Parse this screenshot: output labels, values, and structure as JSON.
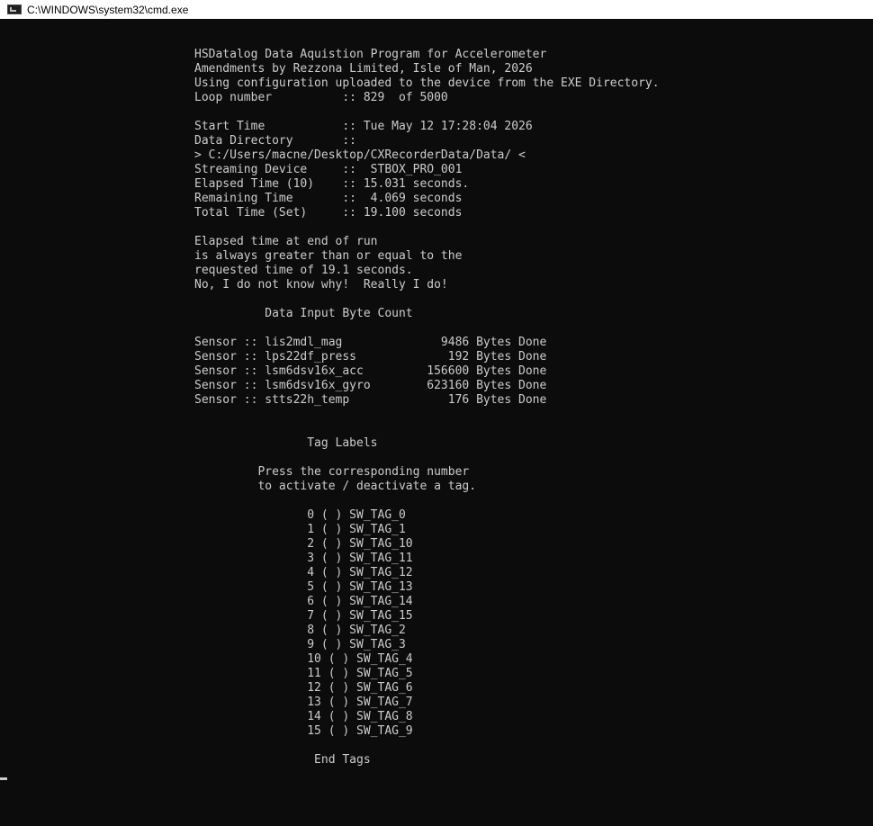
{
  "window": {
    "title": "C:\\WINDOWS\\system32\\cmd.exe",
    "icon": "cmd-console-icon"
  },
  "console": {
    "lines": [
      "HSDatalog Data Aquistion Program for Accelerometer",
      "Amendments by Rezzona Limited, Isle of Man, 2026",
      "Using configuration uploaded to the device from the EXE Directory.",
      "Loop number          :: 829  of 5000",
      "",
      "Start Time           :: Tue May 12 17:28:04 2026",
      "Data Directory       ::",
      "> C:/Users/macne/Desktop/CXRecorderData/Data/ <",
      "Streaming Device     ::  STBOX_PRO_001",
      "Elapsed Time (10)    :: 15.031 seconds.",
      "Remaining Time       ::  4.069 seconds",
      "Total Time (Set)     :: 19.100 seconds",
      "",
      "Elapsed time at end of run",
      "is always greater than or equal to the",
      "requested time of 19.1 seconds.",
      "No, I do not know why!  Really I do!",
      "",
      "          Data Input Byte Count",
      "",
      "Sensor :: lis2mdl_mag              9486 Bytes Done",
      "Sensor :: lps22df_press             192 Bytes Done",
      "Sensor :: lsm6dsv16x_acc         156600 Bytes Done",
      "Sensor :: lsm6dsv16x_gyro        623160 Bytes Done",
      "Sensor :: stts22h_temp              176 Bytes Done",
      "",
      "",
      "                Tag Labels",
      "",
      "         Press the corresponding number",
      "         to activate / deactivate a tag.",
      "",
      "                0 ( ) SW_TAG_0",
      "                1 ( ) SW_TAG_1",
      "                2 ( ) SW_TAG_10",
      "                3 ( ) SW_TAG_11",
      "                4 ( ) SW_TAG_12",
      "                5 ( ) SW_TAG_13",
      "                6 ( ) SW_TAG_14",
      "                7 ( ) SW_TAG_15",
      "                8 ( ) SW_TAG_2",
      "                9 ( ) SW_TAG_3",
      "                10 ( ) SW_TAG_4",
      "                11 ( ) SW_TAG_5",
      "                12 ( ) SW_TAG_6",
      "                13 ( ) SW_TAG_7",
      "                14 ( ) SW_TAG_8",
      "                15 ( ) SW_TAG_9",
      "",
      "                 End Tags"
    ]
  },
  "colors": {
    "background": "#0c0c0c",
    "text": "#cccccc",
    "titlebar": "#ffffff"
  }
}
